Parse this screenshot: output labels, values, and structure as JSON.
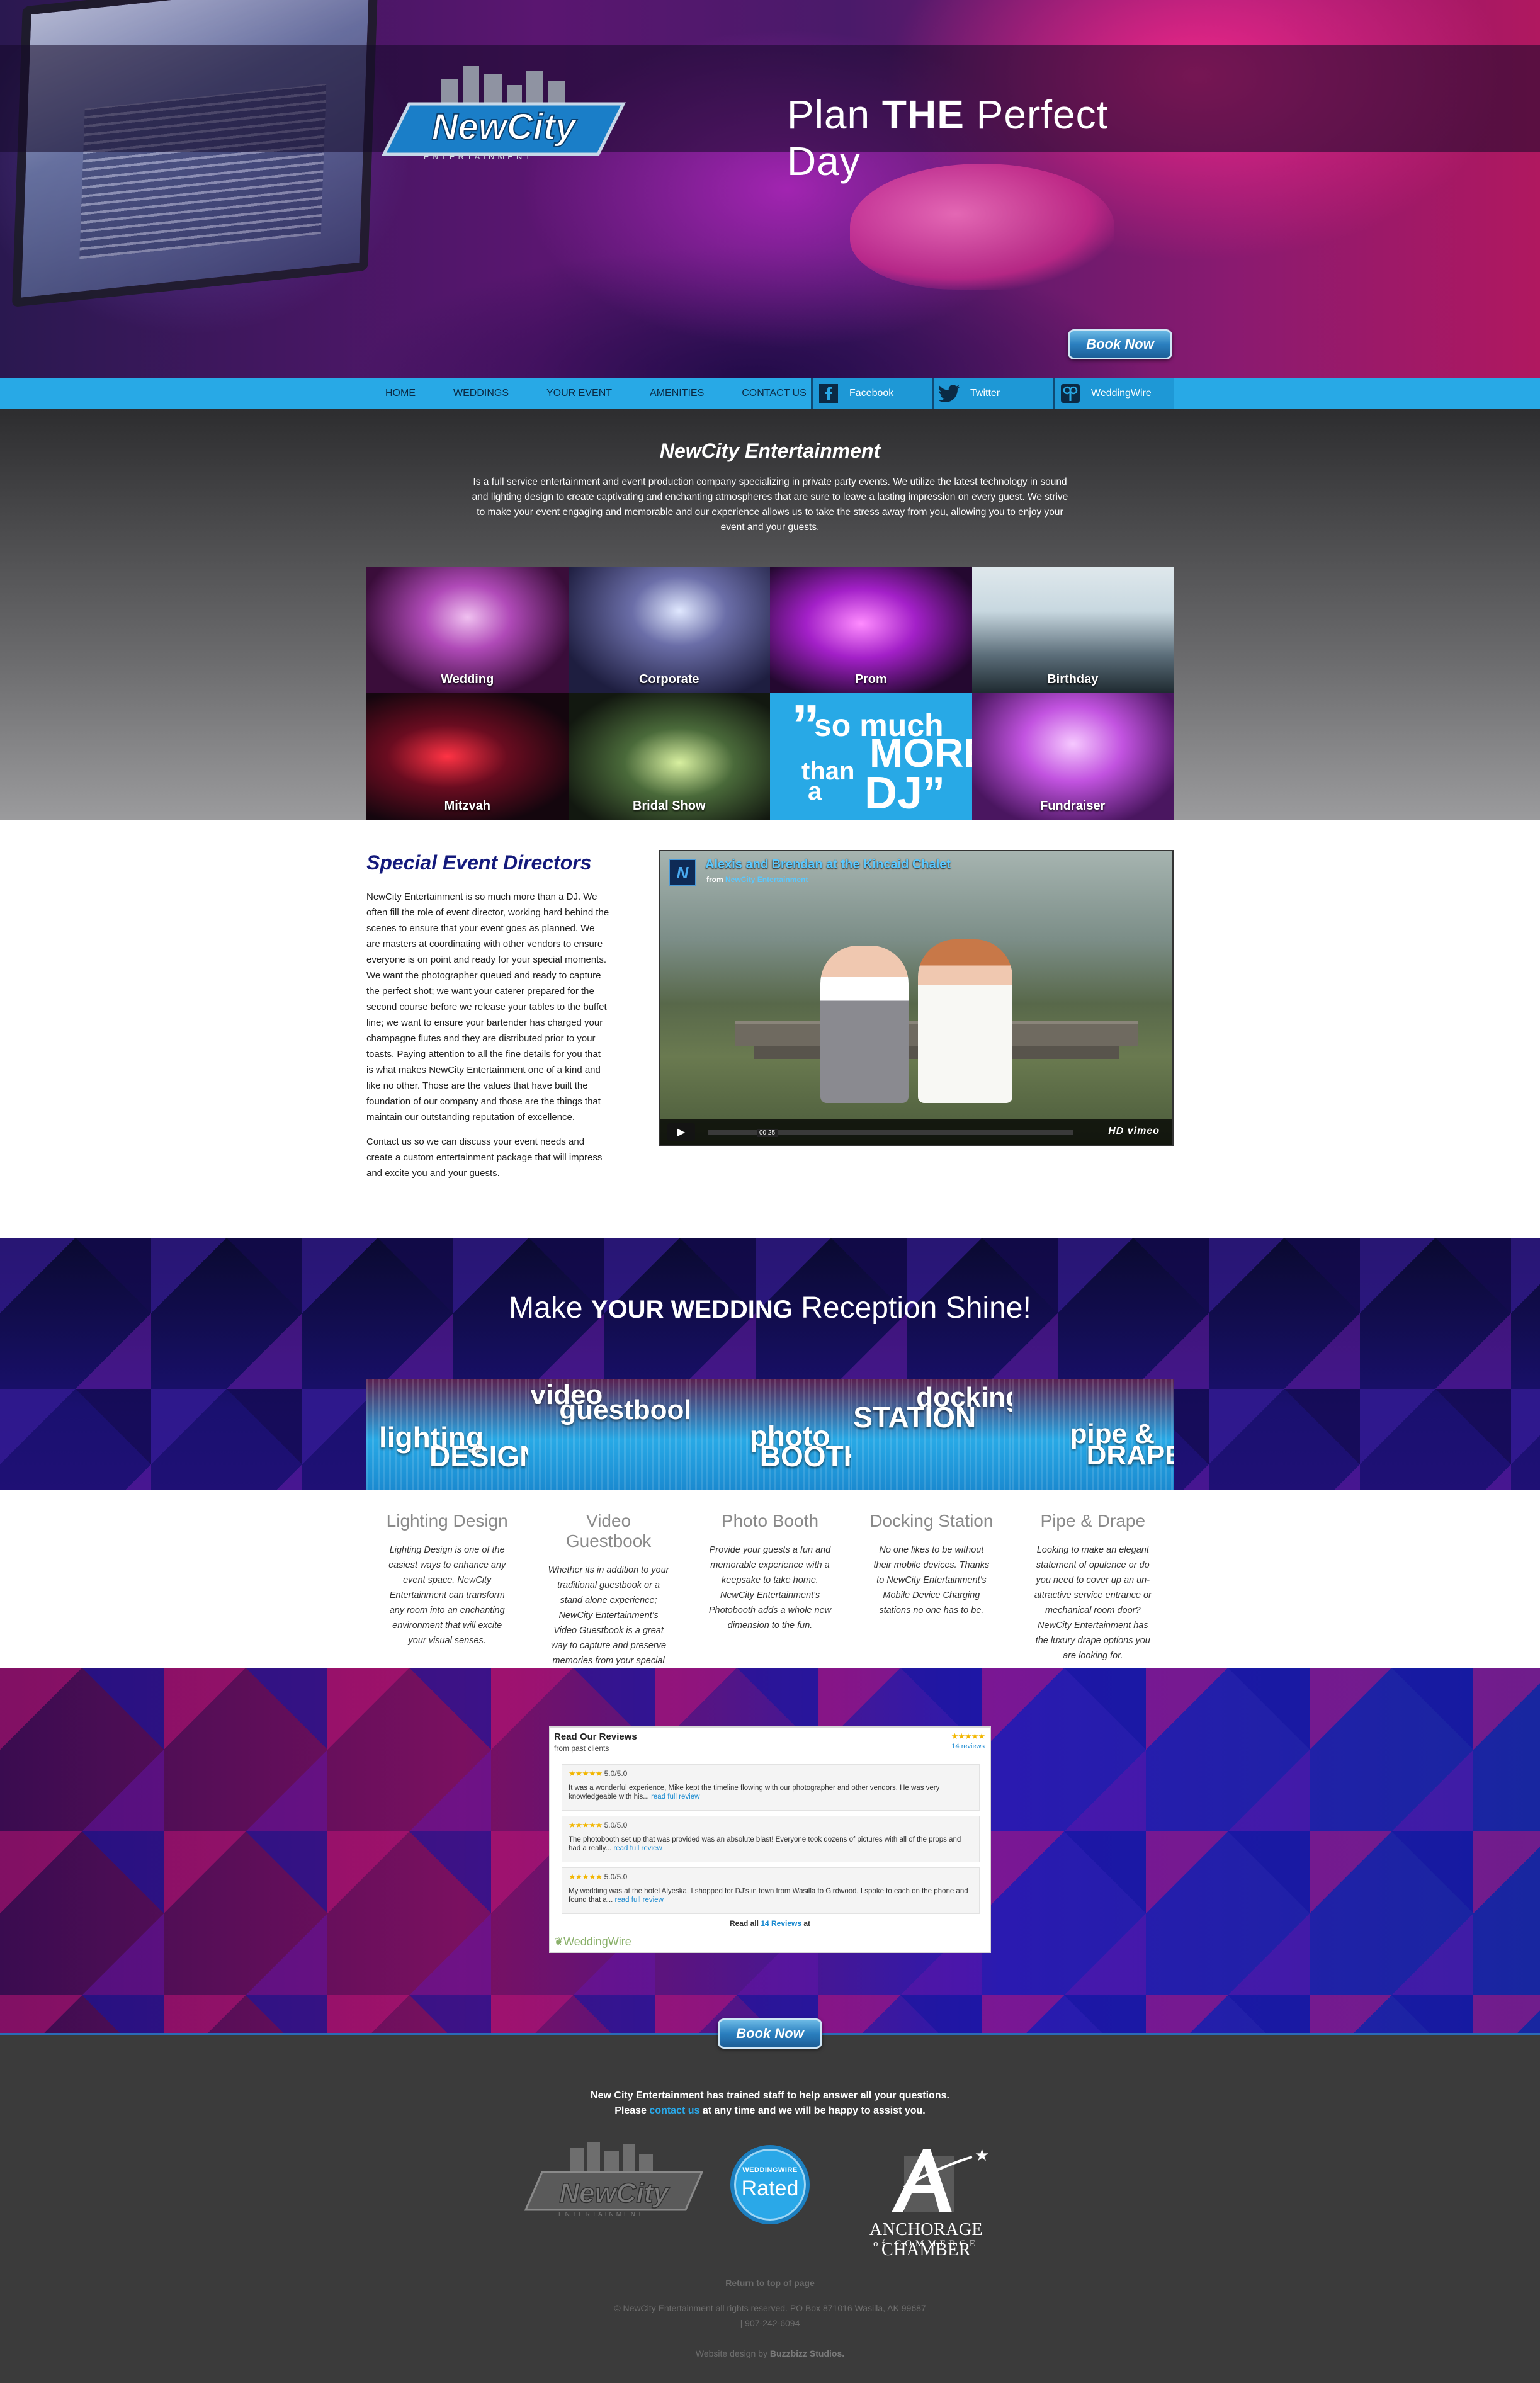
{
  "hero": {
    "logo_text": "NewCity",
    "logo_sub": "ENTERTAINMENT",
    "tagline_pre": "Plan ",
    "tagline_bold": "THE",
    "tagline_post": " Perfect Day",
    "book_now": "Book Now"
  },
  "nav": {
    "items": [
      "HOME",
      "WEDDINGS",
      "YOUR EVENT",
      "AMENITIES",
      "CONTACT US"
    ],
    "social": [
      {
        "label": "Facebook",
        "icon": "facebook-icon"
      },
      {
        "label": "Twitter",
        "icon": "twitter-icon"
      },
      {
        "label": "WeddingWire",
        "icon": "weddingwire-icon"
      }
    ]
  },
  "intro": {
    "title": "NewCity Entertainment",
    "text": "Is a full service entertainment and event production company specializing in private party events. We utilize the latest technology in sound and lighting design to create captivating and enchanting atmospheres that are sure to leave a lasting impression on every guest. We strive to make your event engaging and memorable and our experience allows us to take the stress away from you, allowing you to enjoy your event and your guests."
  },
  "gallery": {
    "tiles": [
      "Wedding",
      "Corporate",
      "Prom",
      "Birthday",
      "Mitzvah",
      "Bridal Show",
      "",
      "Fundraiser"
    ],
    "promo": {
      "quote": "”",
      "l1": "so much",
      "l2": "MORE",
      "l3": "than",
      "l4": "a",
      "l5": "DJ”"
    }
  },
  "special": {
    "title": "Special Event Directors",
    "p1": "NewCity Entertainment is so much more than a DJ. We often fill the role of event director, working hard behind the scenes to ensure that your event goes as planned. We are masters at coordinating with other vendors to ensure everyone is on point and ready for your special moments. We want the photographer queued and ready to capture the perfect shot; we want your caterer prepared for the second course before we release your tables to the buffet line; we want to ensure your bartender has charged your champagne flutes and they are distributed prior to your toasts. Paying attention to all the fine details for you that is what makes NewCity Entertainment one of a kind and like no other. Those are the values that have built the foundation of our company and those are the things that maintain our outstanding reputation of excellence.",
    "p2": "Contact us so we can discuss your event needs and create a custom entertainment package that will impress and excite you and your guests."
  },
  "video": {
    "title": "Alexis and Brendan at the Kincaid Chalet",
    "from": "from",
    "from_name": "NewCity Entertainment",
    "time": "00:25",
    "brand": "HD  vimeo"
  },
  "shine": {
    "title_pre": "Make ",
    "title_bold": "YOUR WEDDING",
    "title_post": " Reception Shine!"
  },
  "features": [
    {
      "tile_a": "lighting",
      "tile_b": "DESIGN",
      "title": "Lighting Design",
      "text": "Lighting Design is one of the easiest ways to enhance any event space. NewCity Entertainment can transform any room into an enchanting environment that will excite your visual senses."
    },
    {
      "tile_a": "video",
      "tile_b": "guestbook",
      "title": "Video Guestbook",
      "text": "Whether its in addition to your traditional guestbook or a stand alone experience; NewCity Entertainment's Video Guestbook is a great way to capture and preserve memories from your special day."
    },
    {
      "tile_a": "photo",
      "tile_b": "BOOTH",
      "title": "Photo Booth",
      "text": "Provide your guests a fun and memorable experience with a keepsake to take home. NewCity Entertainment's Photobooth adds a whole new dimension to the fun."
    },
    {
      "tile_a": "docking",
      "tile_b": "STATION",
      "title": "Docking Station",
      "text": "No one likes to be without their mobile devices. Thanks to NewCity Entertainment's Mobile Device Charging stations no one has to be."
    },
    {
      "tile_a": "pipe &",
      "tile_b": "DRAPE",
      "title": "Pipe & Drape",
      "text": "Looking to make an elegant statement of opulence or do you need to cover up an un-attractive service entrance or mechanical room door? NewCity Entertainment has the luxury drape options you are looking for."
    }
  ],
  "reviews": {
    "title": "Read Our Reviews",
    "subtitle": "from past clients",
    "count_label": "14 reviews",
    "stars": "★★★★★",
    "items": [
      {
        "score": "5.0/5.0",
        "text": "It was a wonderful experience, Mike kept the timeline flowing with our photographer and other vendors. He was very knowledgeable with his...",
        "more": "read full review"
      },
      {
        "score": "5.0/5.0",
        "text": "The photobooth set up that was provided was an absolute blast! Everyone took dozens of pictures with all of the props and had a really...",
        "more": "read full review"
      },
      {
        "score": "5.0/5.0",
        "text": "My wedding was at the hotel Alyeska, I shopped for DJ's in town from Wasilla to Girdwood. I spoke to each on the phone and found that a...",
        "more": "read full review"
      }
    ],
    "all_pre": "Read all ",
    "all_link": "14 Reviews",
    "all_post": " at",
    "ww": "WeddingWire"
  },
  "footer": {
    "book_now": "Book Now",
    "help1": "New City Entertainment has trained staff to help answer all your questions.",
    "help2_pre": "Please ",
    "help2_link": "contact us",
    "help2_post": " at any time and we will be happy to assist you.",
    "rated_top": "WEDDINGWIRE",
    "rated_main": "Rated",
    "acc_name": "ANCHORAGE CHAMBER",
    "acc_sub": "of COMMERCE",
    "back_top": "Return to top of page",
    "copyright": "© NewCity Entertainment all rights reserved. PO Box 871016 Wasilla, AK 99687",
    "phone": "| 907-242-6094",
    "design_pre": "Website design by ",
    "design_name": "Buzzbizz Studios."
  }
}
